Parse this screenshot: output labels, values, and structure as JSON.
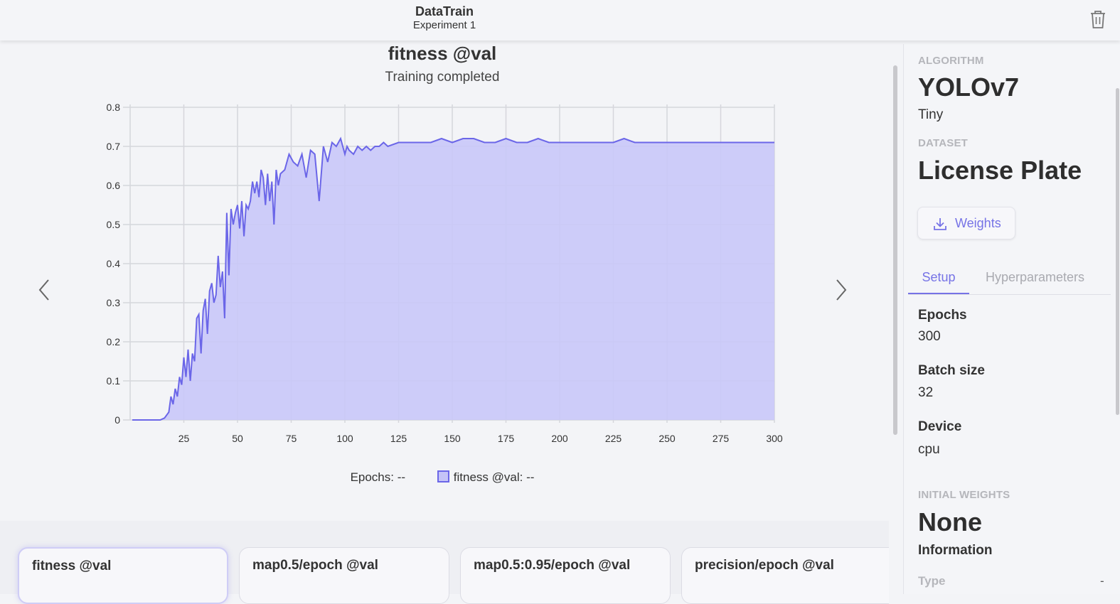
{
  "header": {
    "title": "DataTrain",
    "subtitle": "Experiment 1",
    "delete_icon": "trash-icon"
  },
  "chart": {
    "title": "fitness @val",
    "status": "Training completed",
    "legend": {
      "x_label": "Epochs:",
      "x_value": "--",
      "series_label": "fitness @val:",
      "series_value": "--"
    },
    "prev_icon": "chevron-left-icon",
    "next_icon": "chevron-right-icon"
  },
  "chart_data": {
    "type": "area",
    "title": "fitness @val",
    "xlabel": "",
    "ylabel": "",
    "xlim": [
      0,
      300
    ],
    "ylim": [
      0,
      0.8
    ],
    "x_ticks": [
      25,
      50,
      75,
      100,
      125,
      150,
      175,
      200,
      225,
      250,
      275,
      300
    ],
    "y_ticks": [
      0,
      0.1,
      0.2,
      0.3,
      0.4,
      0.5,
      0.6,
      0.7,
      0.8
    ],
    "grid": true,
    "legend": "bottom",
    "series": [
      {
        "color": "#6b66e8",
        "fill": "#c9c8f8",
        "x": [
          1,
          5,
          10,
          14,
          16,
          18,
          19,
          20,
          21,
          22,
          23,
          24,
          25,
          26,
          27,
          28,
          29,
          30,
          31,
          32,
          33,
          34,
          35,
          36,
          37,
          38,
          39,
          40,
          41,
          42,
          43,
          44,
          45,
          46,
          47,
          48,
          49,
          50,
          51,
          52,
          53,
          54,
          55,
          56,
          57,
          58,
          59,
          60,
          61,
          62,
          63,
          64,
          65,
          66,
          67,
          68,
          69,
          70,
          72,
          74,
          76,
          78,
          80,
          82,
          84,
          86,
          88,
          90,
          92,
          94,
          96,
          98,
          100,
          101,
          102,
          104,
          106,
          108,
          110,
          112,
          114,
          116,
          118,
          120,
          125,
          130,
          135,
          140,
          145,
          150,
          155,
          160,
          165,
          170,
          175,
          180,
          185,
          190,
          195,
          200,
          205,
          210,
          215,
          220,
          225,
          230,
          235,
          240,
          245,
          250,
          255,
          260,
          265,
          270,
          275,
          280,
          285,
          290,
          295,
          300
        ],
        "y": [
          0,
          0,
          0,
          0,
          0.005,
          0.02,
          0.06,
          0.04,
          0.08,
          0.06,
          0.11,
          0.09,
          0.16,
          0.11,
          0.18,
          0.1,
          0.17,
          0.15,
          0.26,
          0.27,
          0.17,
          0.28,
          0.31,
          0.22,
          0.33,
          0.35,
          0.3,
          0.32,
          0.42,
          0.34,
          0.38,
          0.26,
          0.53,
          0.37,
          0.54,
          0.5,
          0.53,
          0.55,
          0.49,
          0.56,
          0.47,
          0.55,
          0.54,
          0.56,
          0.61,
          0.58,
          0.61,
          0.57,
          0.64,
          0.62,
          0.55,
          0.63,
          0.56,
          0.61,
          0.5,
          0.64,
          0.6,
          0.63,
          0.64,
          0.68,
          0.66,
          0.65,
          0.68,
          0.62,
          0.69,
          0.68,
          0.56,
          0.7,
          0.66,
          0.71,
          0.7,
          0.72,
          0.68,
          0.7,
          0.69,
          0.68,
          0.7,
          0.69,
          0.7,
          0.69,
          0.7,
          0.7,
          0.71,
          0.7,
          0.71,
          0.71,
          0.71,
          0.71,
          0.72,
          0.71,
          0.72,
          0.72,
          0.71,
          0.71,
          0.72,
          0.71,
          0.71,
          0.72,
          0.71,
          0.71,
          0.71,
          0.71,
          0.71,
          0.71,
          0.71,
          0.72,
          0.71,
          0.71,
          0.71,
          0.71,
          0.71,
          0.71,
          0.71,
          0.71,
          0.71,
          0.71,
          0.71,
          0.71,
          0.71,
          0.71
        ]
      }
    ]
  },
  "cards": [
    {
      "title": "fitness @val",
      "active": true
    },
    {
      "title": "map0.5/epoch @val",
      "active": false
    },
    {
      "title": "map0.5:0.95/epoch @val",
      "active": false
    },
    {
      "title": "precision/epoch @val",
      "active": false
    }
  ],
  "side": {
    "algorithm_label": "ALGORITHM",
    "algorithm": "YOLOv7",
    "algorithm_variant": "Tiny",
    "dataset_label": "DATASET",
    "dataset": "License Plate",
    "weights_button": "Weights",
    "weights_icon": "download-icon",
    "tabs": [
      "Setup",
      "Hyperparameters"
    ],
    "fields": [
      {
        "label": "Epochs",
        "value": "300"
      },
      {
        "label": "Batch size",
        "value": "32"
      },
      {
        "label": "Device",
        "value": "cpu"
      }
    ],
    "initial_weights_label": "INITIAL WEIGHTS",
    "initial_weights": "None",
    "information_title": "Information",
    "type_label": "Type",
    "type_value": "-"
  },
  "colors": {
    "accent": "#7673e6",
    "series_line": "#6b66e8",
    "series_fill": "#c9c8f8"
  }
}
